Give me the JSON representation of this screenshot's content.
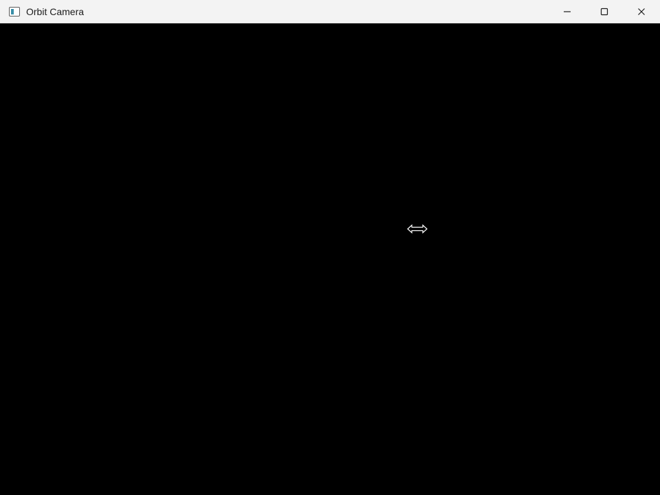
{
  "window": {
    "title": "Orbit Camera",
    "controls": {
      "minimize": "minimize-icon",
      "maximize": "maximize-icon",
      "close": "close-icon"
    }
  },
  "viewport": {
    "background": "#000000",
    "cursor": "horizontal-resize-cursor-icon"
  }
}
